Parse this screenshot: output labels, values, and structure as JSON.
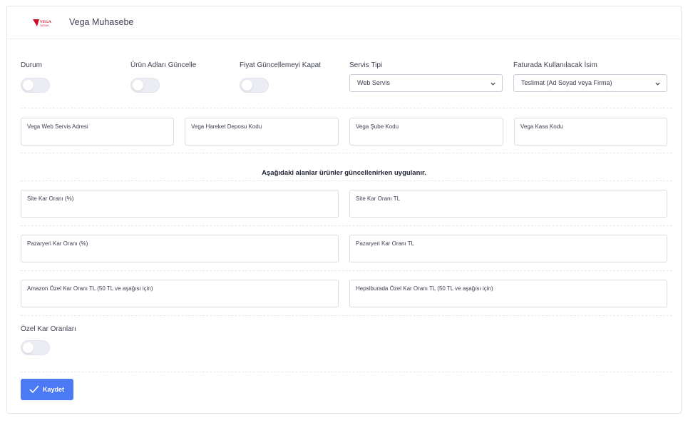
{
  "header": {
    "title": "Vega Muhasebe",
    "logo_icon": "vega-logo-icon"
  },
  "settings": {
    "status_label": "Durum",
    "update_product_names_label": "Ürün Adları Güncelle",
    "disable_price_update_label": "Fiyat Güncellemeyi Kapat",
    "service_type_label": "Servis Tipi",
    "service_type_value": "Web Servis",
    "invoice_name_label": "Faturada Kullanılacak İsim",
    "invoice_name_value": "Teslimat (Ad Soyad veya Firma)"
  },
  "fields_row1": {
    "web_service_address": "Vega Web Servis Adresi",
    "movement_depot_code": "Vega Hareket Deposu Kodu",
    "branch_code": "Vega Şube Kodu",
    "cash_code": "Vega Kasa Kodu"
  },
  "notice": "Aşağıdaki alanlar ürünler güncellenirken uygulanır.",
  "fields_margin": {
    "site_margin_percent": "Site Kar Oranı (%)",
    "site_margin_tl": "Site Kar Oranı TL",
    "marketplace_margin_percent": "Pazaryeri Kar Oranı (%)",
    "marketplace_margin_tl": "Pazaryeri Kar Oranı TL",
    "amazon_special_margin": "Amazon Özel Kar Oranı TL (50 TL ve aşağısı için)",
    "hepsiburada_special_margin": "Hepsiburada Özel Kar Oranı TL (50 TL ve aşağısı için)"
  },
  "special_rates_label": "Özel Kar Oranları",
  "save_button_label": "Kaydet",
  "colors": {
    "primary": "#4c79f5",
    "toggle_off": "#ebedf3",
    "logo_red": "#c8102e"
  }
}
